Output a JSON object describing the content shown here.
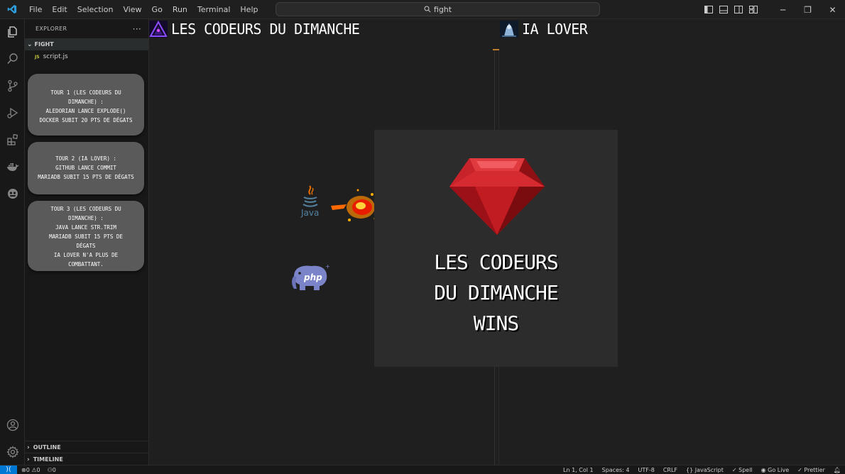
{
  "window": {
    "menu": [
      "File",
      "Edit",
      "Selection",
      "View",
      "Go",
      "Run",
      "Terminal",
      "Help"
    ],
    "search_text": "fight"
  },
  "sidebar": {
    "explorer_title": "EXPLORER",
    "folder_name": "FIGHT",
    "file_badge": "JS",
    "file_name": "script.js",
    "outline_label": "OUTLINE",
    "timeline_label": "TIMELINE"
  },
  "battle_log": [
    {
      "text": "TOUR 1 (LES CODEURS DU\nDIMANCHE) :\nALEDORIAN LANCE EXPLODE()\nDOCKER SUBIT 20 PTS DE DÉGATS"
    },
    {
      "text": "TOUR 2 (IA LOVER) :\nGITHUB LANCE COMMIT\nMARIADB SUBIT 15 PTS DE DÉGATS"
    },
    {
      "text": "TOUR 3 (LES CODEURS DU\nDIMANCHE) :\nJAVA LANCE STR.TRIM\nMARIADB SUBIT 15 PTS DE\nDÉGATS\nIA LOVER N'A PLUS DE\nCOMBATTANT."
    }
  ],
  "game": {
    "team_left": "LES CODEURS DU DIMANCHE",
    "team_right": "IA LOVER",
    "java_label": "Java",
    "php_label": "php",
    "winner_text": "LES CODEURS\nDU DIMANCHE\nWINS"
  },
  "status": {
    "errors": "0",
    "warnings": "0",
    "ports": "0",
    "cursor": "Ln 1, Col 1",
    "spaces": "Spaces: 4",
    "encoding": "UTF-8",
    "eol": "CRLF",
    "language": "JavaScript",
    "spell": "Spell",
    "golive": "Go Live",
    "prettier": "Prettier"
  },
  "colors": {
    "accent": "#0078d4",
    "ruby": "#c0151d",
    "panel": "#2c2c2c",
    "card": "#5a5a5a"
  }
}
